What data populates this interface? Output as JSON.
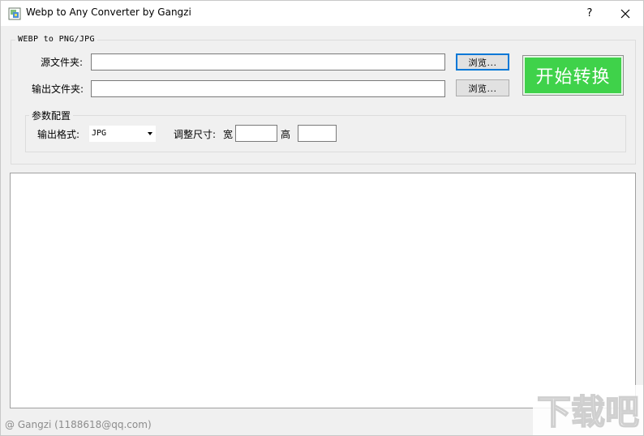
{
  "window": {
    "title": "Webp to Any Converter by Gangzi",
    "help_label": "?",
    "close_icon": "close-icon"
  },
  "main_group": {
    "title": "WEBP to PNG/JPG",
    "source_folder_label": "源文件夹:",
    "source_folder_value": "",
    "output_folder_label": "输出文件夹:",
    "output_folder_value": "",
    "browse_label_1": "浏览...",
    "browse_label_2": "浏览...",
    "start_label": "开始转换",
    "start_color": "#3fd24a"
  },
  "params": {
    "title": "参数配置",
    "format_label": "输出格式:",
    "format_value": "JPG",
    "resize_label": "调整尺寸:",
    "width_label": "宽",
    "width_value": "",
    "height_label": "高",
    "height_value": ""
  },
  "log": {
    "content": ""
  },
  "status": {
    "text": "@ Gangzi (1188618@qq.com)"
  },
  "watermark": {
    "text": "下载吧"
  }
}
